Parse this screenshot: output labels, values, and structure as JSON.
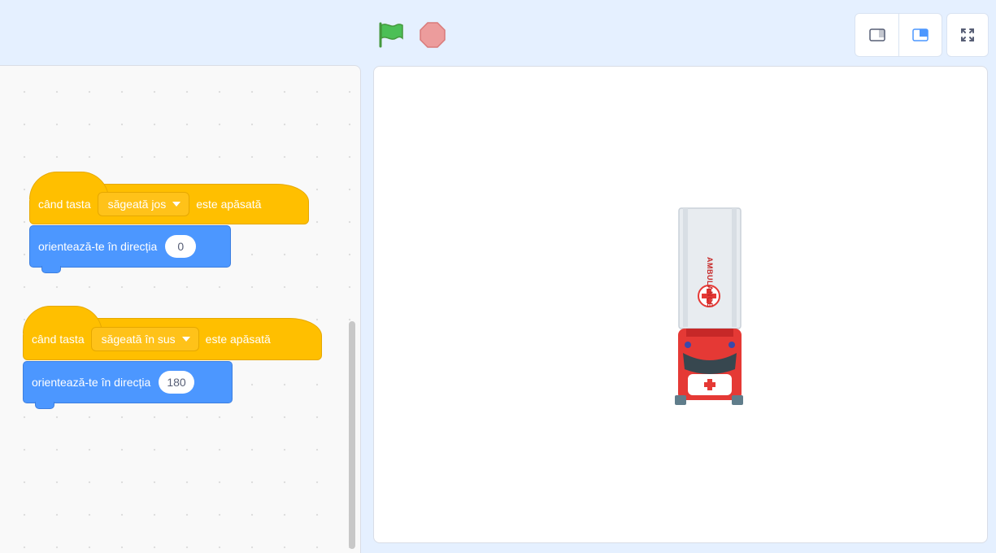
{
  "toolbar": {
    "green_flag_icon": "green-flag-icon",
    "stop_icon": "stop-sign-icon",
    "small_stage_icon": "small-stage-icon",
    "normal_stage_icon": "normal-stage-icon",
    "fullscreen_icon": "fullscreen-icon"
  },
  "scripts": [
    {
      "hat": {
        "prefix": "când tasta",
        "key": "săgeată jos",
        "suffix": "este apăsată"
      },
      "motion": {
        "label": "orientează-te în direcția",
        "value": "0"
      }
    },
    {
      "hat": {
        "prefix": "când tasta",
        "key": "săgeată în sus",
        "suffix": "este apăsată"
      },
      "motion": {
        "label": "orientează-te în direcția",
        "value": "180"
      }
    }
  ],
  "sprite": {
    "name_on_vehicle": "AMBULANCE"
  },
  "colors": {
    "events": "#ffbf00",
    "motion": "#4c97ff",
    "green_flag": "#4cbf56",
    "stop": "#ec9c9c",
    "accent": "#4c97ff"
  }
}
